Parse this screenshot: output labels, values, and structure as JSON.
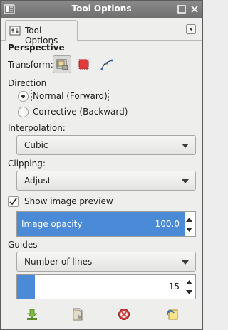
{
  "window": {
    "title": "Tool Options",
    "icons": [
      "app-icon",
      "window-menu-icon",
      "window-close-icon"
    ]
  },
  "tab": {
    "label": "Tool Options",
    "icon": "tool-options-icon",
    "menu_icon": "tab-menu-icon"
  },
  "tool": {
    "name": "Perspective",
    "transform_label": "Transform:",
    "transform_modes": [
      {
        "icon": "layer-transform-icon",
        "active": true
      },
      {
        "icon": "selection-transform-icon",
        "active": false
      },
      {
        "icon": "path-transform-icon",
        "active": false
      }
    ]
  },
  "direction": {
    "label": "Direction",
    "options": [
      {
        "label": "Normal (Forward)",
        "checked": true
      },
      {
        "label": "Corrective (Backward)",
        "checked": false
      }
    ]
  },
  "interpolation": {
    "label": "Interpolation:",
    "value": "Cubic"
  },
  "clipping": {
    "label": "Clipping:",
    "value": "Adjust"
  },
  "preview": {
    "label": "Show image preview",
    "checked": true
  },
  "opacity": {
    "label": "Image opacity",
    "value": "100.0",
    "fill_fraction": 1.0
  },
  "guides": {
    "label": "Guides",
    "value": "Number of lines",
    "lines_value": "15",
    "fill_fraction": 0.1
  },
  "colors": {
    "accent": "#4a8ad6",
    "titlebar": "#7b7b7b"
  },
  "bottom_buttons": [
    {
      "icon": "save-options-icon"
    },
    {
      "icon": "restore-options-icon"
    },
    {
      "icon": "delete-options-icon"
    },
    {
      "icon": "reset-options-icon"
    }
  ]
}
